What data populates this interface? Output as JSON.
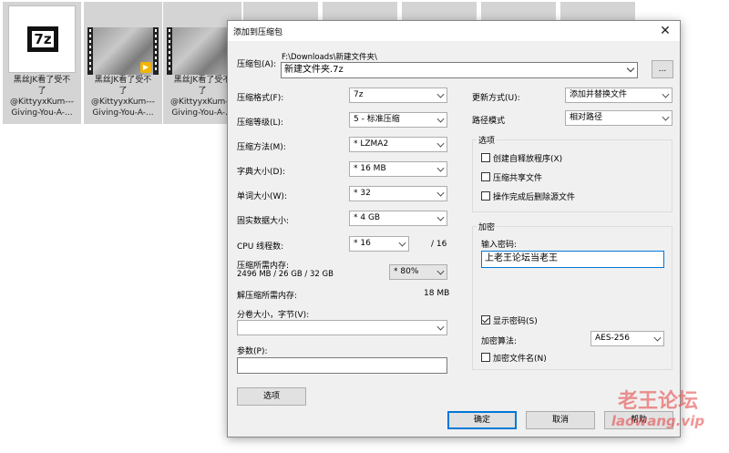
{
  "explorer": {
    "files": [
      {
        "name_lines": [
          "黑丝JK看了受不",
          "了",
          "@KittyyxKum---",
          "Giving-You-A-..."
        ],
        "thumb": "7z-archive-icon"
      },
      {
        "name_lines": [
          "黑丝JK看了受不",
          "了",
          "@KittyyxKum---",
          "Giving-You-A-..."
        ],
        "thumb": "video-thumbnail",
        "badge": "▶"
      },
      {
        "name_lines": [
          "黑丝JK看了受不",
          "了",
          "@KittyyxKum---",
          "Giving-You-A-..."
        ],
        "thumb": "video-thumbnail"
      }
    ],
    "logo_text": "7z"
  },
  "dialog": {
    "title": "添加到压缩包",
    "close_glyph": "✕",
    "archive": {
      "label": "压缩包(A):",
      "path": "F:\\Downloads\\新建文件夹\\",
      "filename": "新建文件夹.7z",
      "browse_label": "..."
    },
    "left": {
      "format": {
        "label": "压缩格式(F):",
        "value": "7z"
      },
      "level": {
        "label": "压缩等级(L):",
        "value": "5 - 标准压缩"
      },
      "method": {
        "label": "压缩方法(M):",
        "value": "* LZMA2"
      },
      "dict": {
        "label": "字典大小(D):",
        "value": "* 16 MB"
      },
      "word": {
        "label": "单词大小(W):",
        "value": "* 32"
      },
      "solid": {
        "label": "固实数据大小:",
        "value": "* 4 GB"
      },
      "cpu": {
        "label": "CPU 线程数:",
        "value": "* 16",
        "total": "/ 16"
      },
      "mem": {
        "label": "压缩所需内存:",
        "detail": "2496 MB / 26 GB / 32 GB",
        "value": "* 80%"
      },
      "decomp": {
        "label": "解压缩所需内存:",
        "value": "18 MB"
      },
      "split": {
        "label": "分卷大小，字节(V):",
        "value": ""
      },
      "params": {
        "label": "参数(P):",
        "value": ""
      },
      "options_button": "选项"
    },
    "right": {
      "update": {
        "label": "更新方式(U):",
        "value": "添加并替换文件"
      },
      "path_mode": {
        "label": "路径模式",
        "value": "相对路径"
      },
      "options": {
        "title": "选项",
        "sfx": {
          "label": "创建自释放程序(X)",
          "checked": false
        },
        "shared": {
          "label": "压缩共享文件",
          "checked": false
        },
        "delete": {
          "label": "操作完成后删除源文件",
          "checked": false
        }
      },
      "encryption": {
        "title": "加密",
        "password_label": "输入密码:",
        "password_value": "上老王论坛当老王",
        "show_password": {
          "label": "显示密码(S)",
          "checked": true
        },
        "method_label": "加密算法:",
        "method_value": "AES-256",
        "encrypt_names": {
          "label": "加密文件名(N)",
          "checked": false
        }
      }
    },
    "buttons": {
      "ok": "确定",
      "cancel": "取消",
      "help": "帮助"
    }
  },
  "watermark": {
    "cn": "老王论坛",
    "en": "laowang.vip"
  }
}
